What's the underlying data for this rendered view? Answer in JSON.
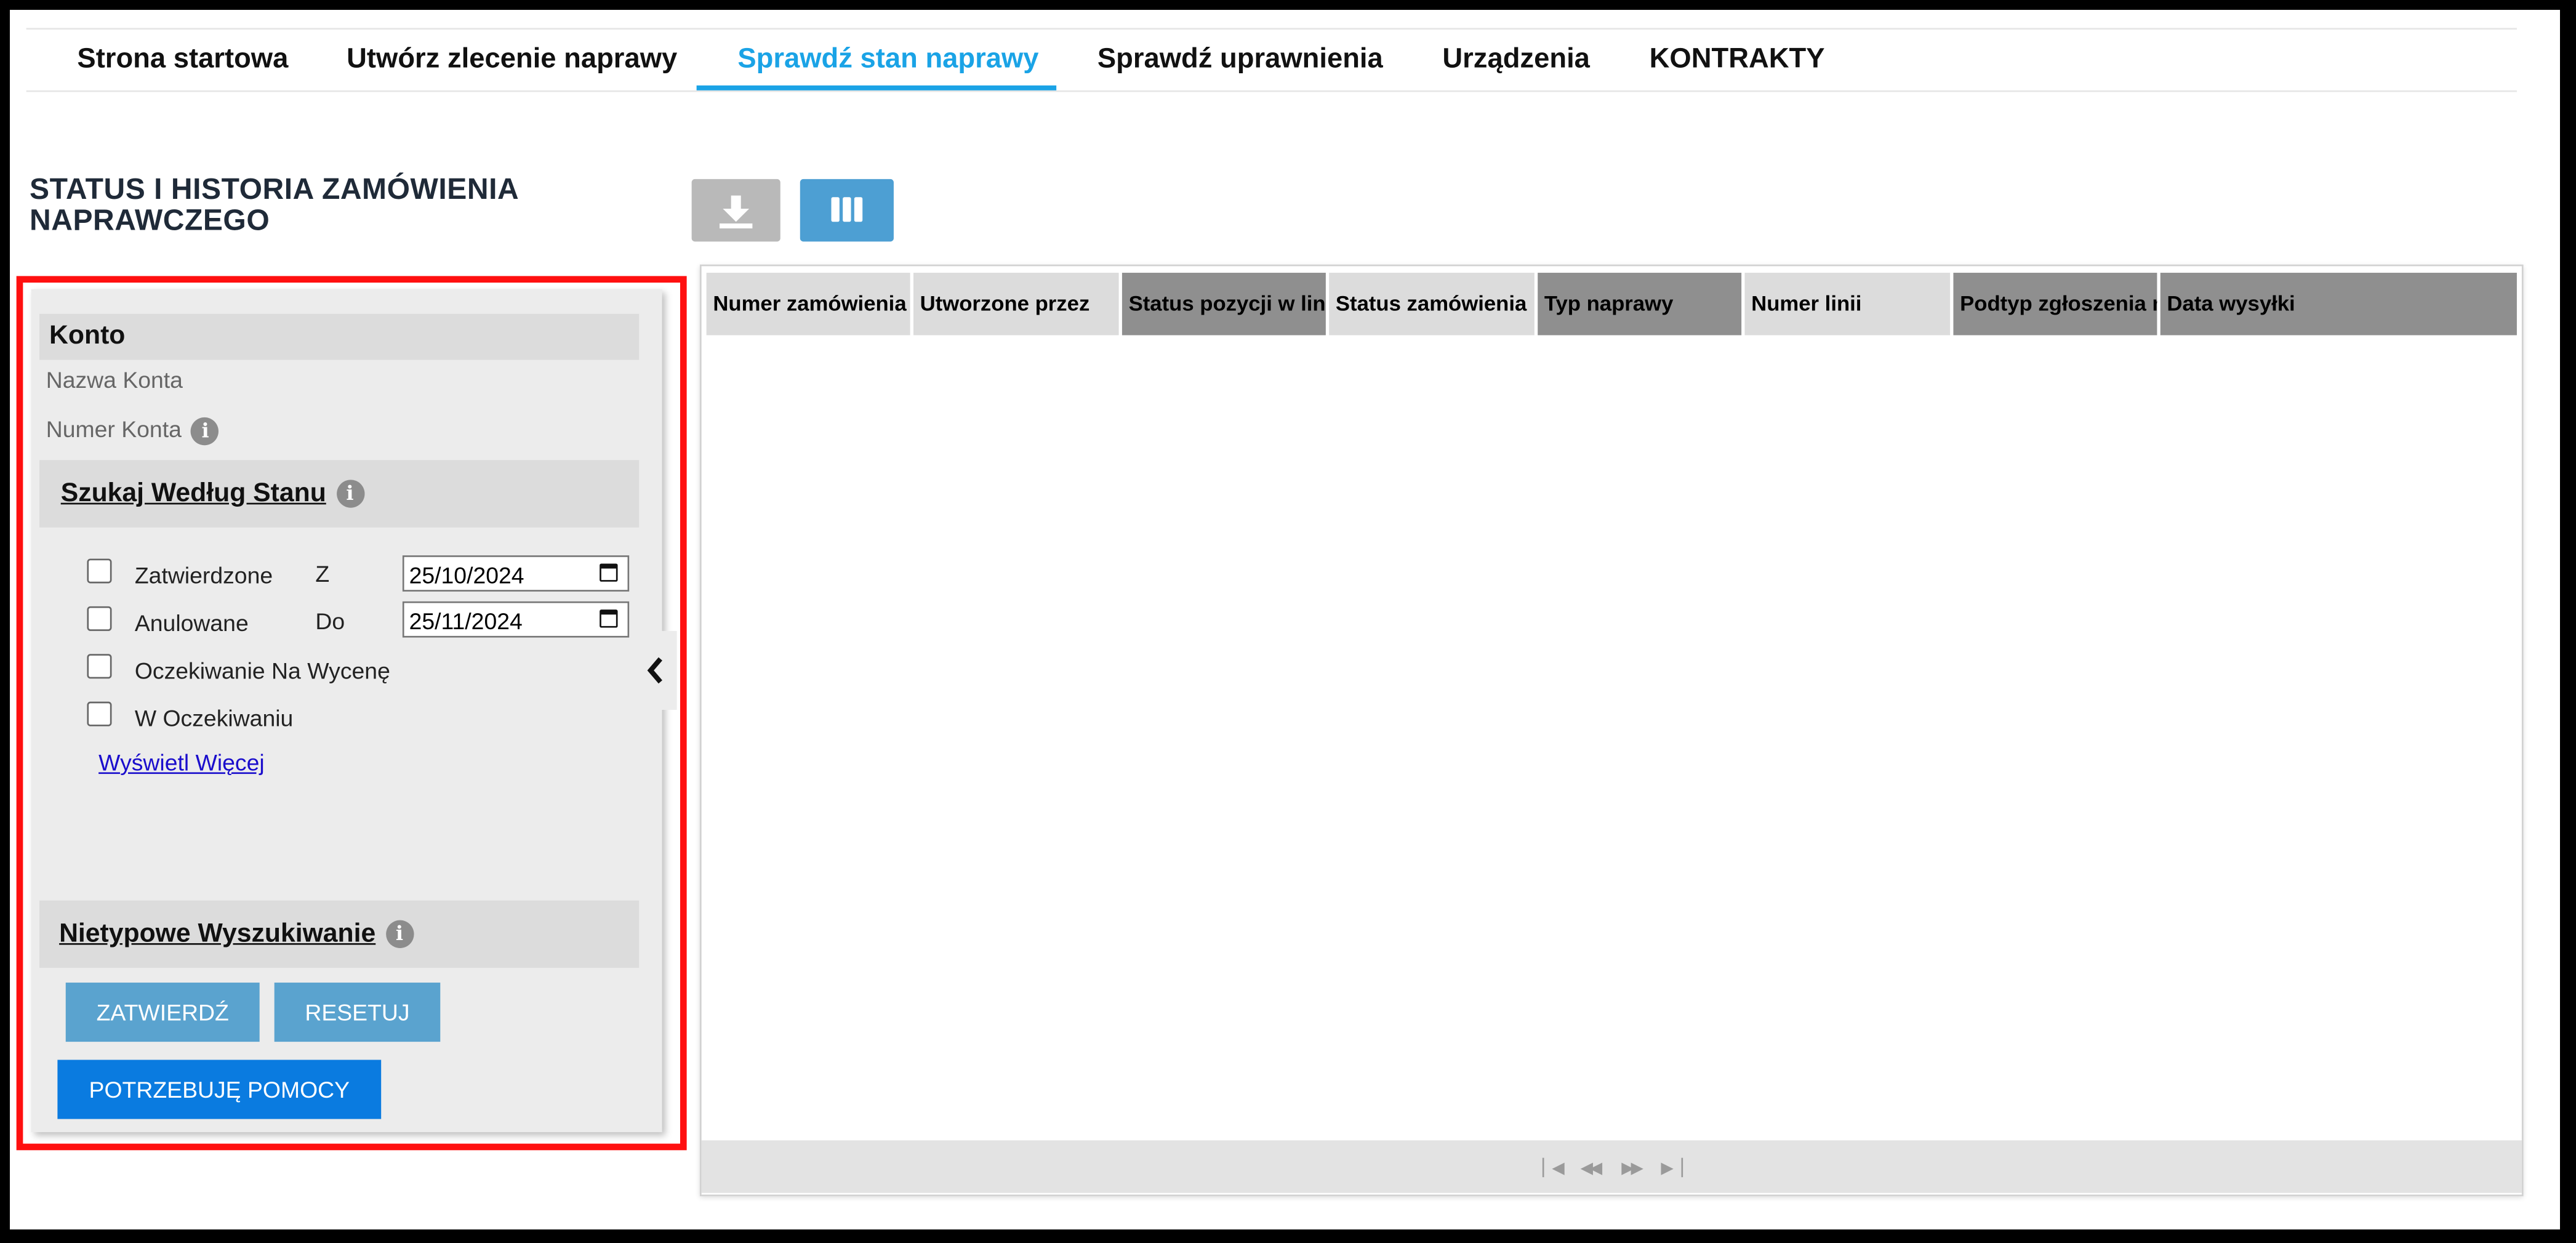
{
  "nav": {
    "tabs": [
      {
        "label": "Strona startowa"
      },
      {
        "label": "Utwórz zlecenie naprawy"
      },
      {
        "label": "Sprawdź stan naprawy",
        "active": true
      },
      {
        "label": "Sprawdź uprawnienia"
      },
      {
        "label": "Urządzenia"
      },
      {
        "label": "KONTRAKTY"
      }
    ]
  },
  "page_title": "STATUS I HISTORIA ZAMÓWIENIA NAPRAWCZEGO",
  "toolbar": {
    "download_icon": "download-icon",
    "columns_icon": "columns-icon"
  },
  "filters": {
    "account": {
      "title": "Konto",
      "name_label": "Nazwa Konta",
      "number_label": "Numer Konta"
    },
    "status_search": {
      "title": "Szukaj Według Stanu",
      "options": [
        {
          "label": "Zatwierdzone",
          "checked": false
        },
        {
          "label": "Anulowane",
          "checked": false
        },
        {
          "label": "Oczekiwanie Na Wycenę",
          "checked": false
        },
        {
          "label": "W Oczekiwaniu",
          "checked": false
        }
      ],
      "from_label": "Z",
      "from_value": "25/10/2024",
      "to_label": "Do",
      "to_value": "25/11/2024",
      "show_more": "Wyświetl Więcej"
    },
    "custom_search": {
      "title": "Nietypowe Wyszukiwanie"
    },
    "buttons": {
      "submit": "ZATWIERDŹ",
      "reset": "RESETUJ",
      "help": "POTRZEBUJĘ POMOCY"
    }
  },
  "grid": {
    "columns": [
      "Numer zamówienia",
      "Utworzone przez",
      "Status pozycji w linii",
      "Status zamówienia",
      "Typ naprawy",
      "Numer linii",
      "Podtyp zgłoszenia naprawy",
      "Data wysyłki"
    ],
    "rows": []
  },
  "colors": {
    "accent": "#1aa3e6",
    "primary_button": "#0a7be0",
    "secondary_button": "#5aa3cf",
    "highlight_frame": "#ff1010"
  }
}
